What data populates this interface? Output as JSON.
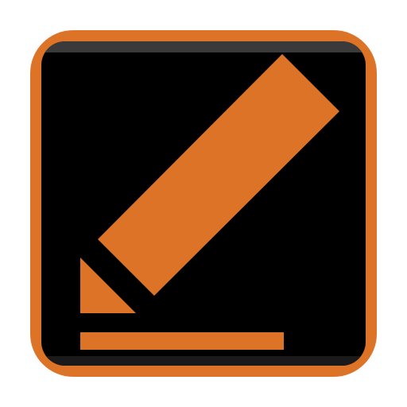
{
  "icon": {
    "name": "edit-icon",
    "colors": {
      "frame": "#DD7326",
      "tile": "#000000",
      "tile_top_sheen": "#3A3A3A",
      "tile_bottom_shade": "#1A1A1A",
      "glyph": "#DD7326",
      "background": "#FFFFFF"
    }
  }
}
